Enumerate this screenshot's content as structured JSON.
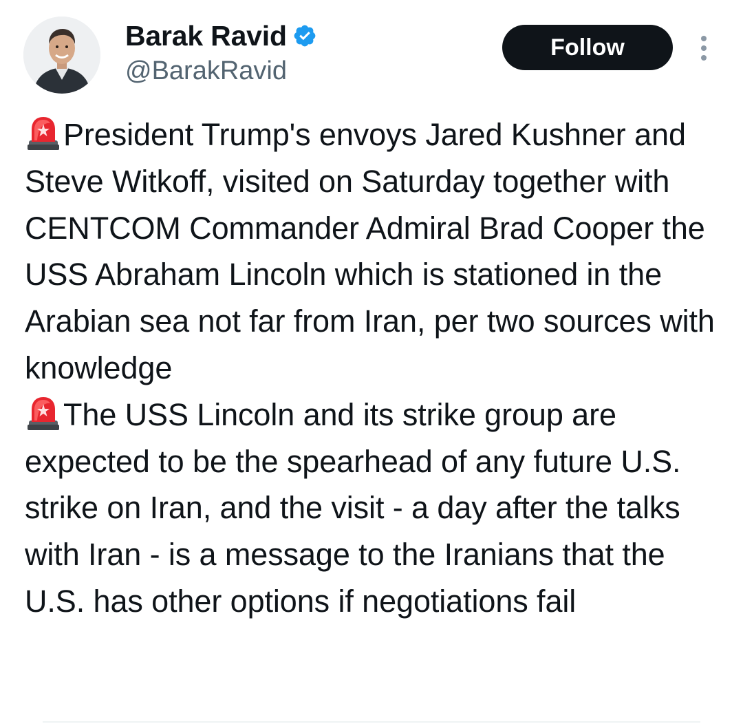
{
  "tweet": {
    "author": {
      "display_name": "Barak Ravid",
      "handle": "@BarakRavid",
      "verified": true,
      "verified_icon": "verified-badge-icon",
      "avatar": "profile-photo"
    },
    "follow_label": "Follow",
    "more_icon": "more-dots-icon",
    "paragraphs": [
      {
        "icon": "siren-icon",
        "text": "President Trump's envoys Jared Kushner and Steve Witkoff, visited on Saturday together with CENTCOM Commander Admiral Brad Cooper the USS Abraham Lincoln which is stationed in the Arabian sea not far from Iran, per two sources with knowledge"
      },
      {
        "icon": "siren-icon",
        "text": "The USS Lincoln and its strike group are expected to be the spearhead of any future U.S. strike on Iran, and the visit - a day after the talks with Iran - is a message to the Iranians that the U.S. has other options if negotiations fail"
      }
    ]
  },
  "colors": {
    "text": "#0f1419",
    "secondary": "#536471",
    "verified_blue": "#1d9bf0",
    "follow_bg": "#0f1419",
    "follow_text": "#ffffff"
  }
}
